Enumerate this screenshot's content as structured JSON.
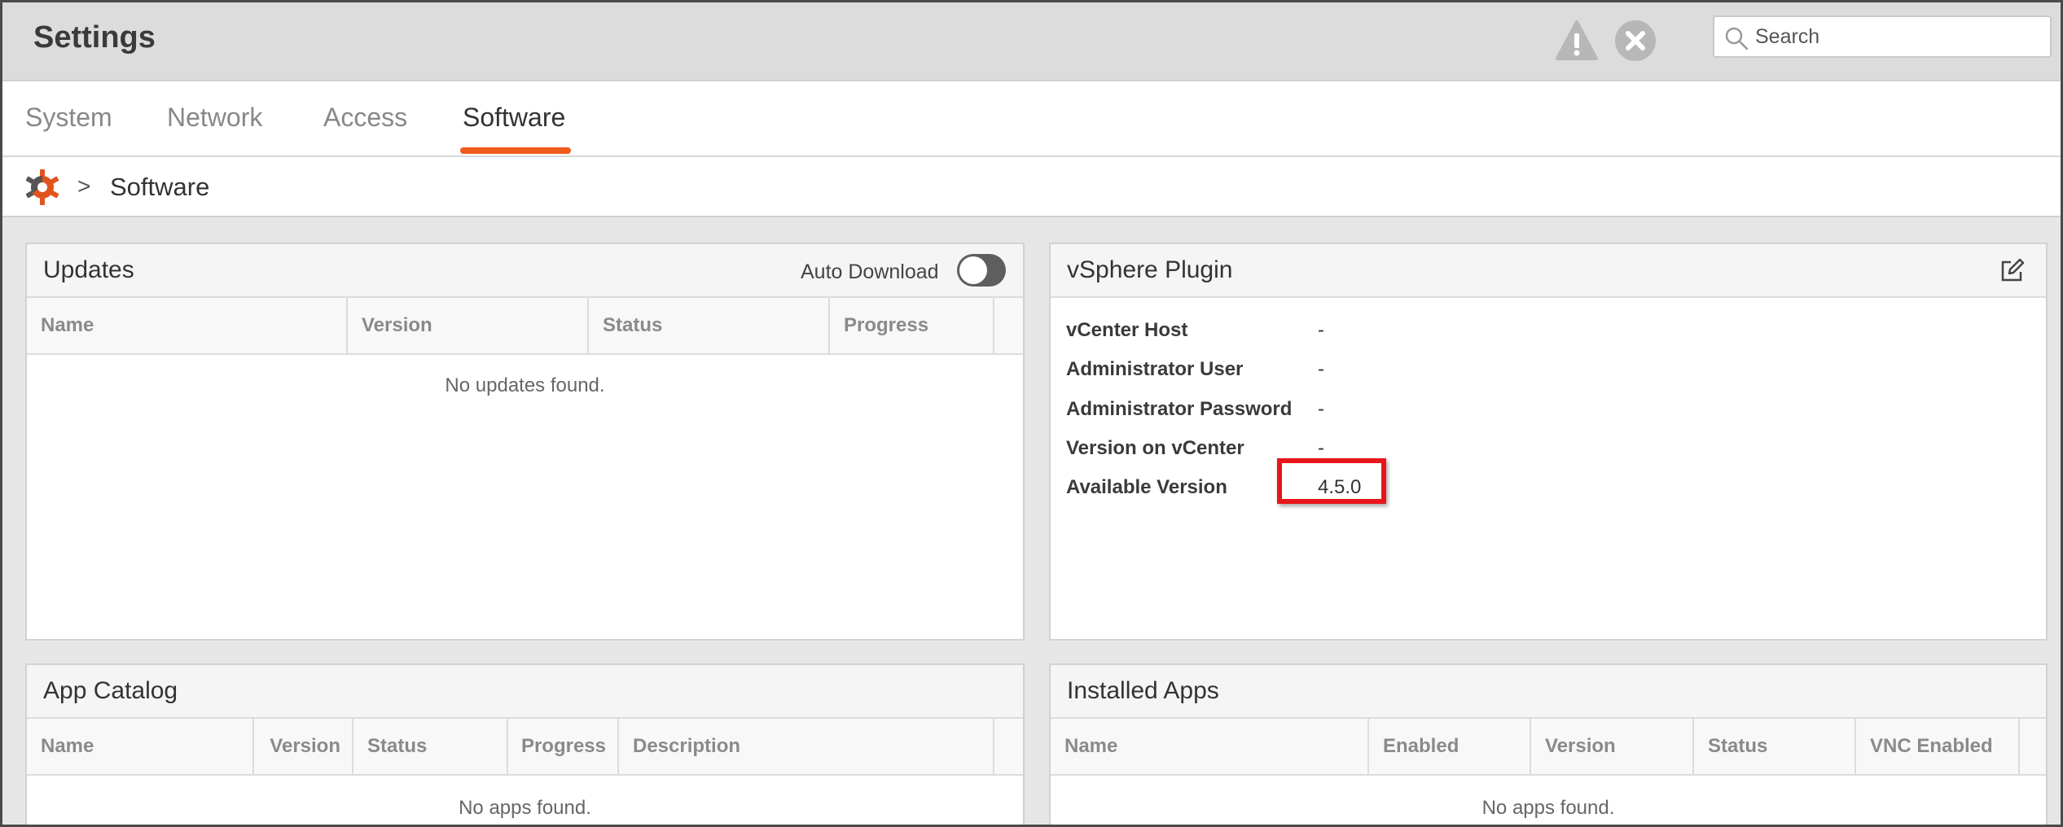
{
  "header": {
    "title": "Settings",
    "search_placeholder": "Search",
    "icons": {
      "warning": "warning-icon",
      "close": "close-icon",
      "search": "search-icon"
    }
  },
  "tabs": [
    {
      "label": "System",
      "active": false
    },
    {
      "label": "Network",
      "active": false
    },
    {
      "label": "Access",
      "active": false
    },
    {
      "label": "Software",
      "active": true
    }
  ],
  "breadcrumb": {
    "separator": ">",
    "current": "Software",
    "root_icon": "settings-gear-icon"
  },
  "updates": {
    "title": "Updates",
    "auto_download_label": "Auto Download",
    "auto_download_on": false,
    "columns": [
      "Name",
      "Version",
      "Status",
      "Progress"
    ],
    "empty_message": "No updates found."
  },
  "vsphere": {
    "title": "vSphere Plugin",
    "rows": [
      {
        "label": "vCenter Host",
        "value": "-"
      },
      {
        "label": "Administrator User",
        "value": "-"
      },
      {
        "label": "Administrator Password",
        "value": "-"
      },
      {
        "label": "Version on vCenter",
        "value": "-"
      },
      {
        "label": "Available Version",
        "value": "4.5.0"
      }
    ]
  },
  "app_catalog": {
    "title": "App Catalog",
    "columns": [
      "Name",
      "Version",
      "Status",
      "Progress",
      "Description"
    ],
    "empty_message": "No apps found."
  },
  "installed_apps": {
    "title": "Installed Apps",
    "columns": [
      "Name",
      "Enabled",
      "Version",
      "Status",
      "VNC Enabled"
    ],
    "empty_message": "No apps found."
  },
  "colors": {
    "accent": "#f05a1a",
    "highlight": "#e8151b",
    "header_bg": "#dcdcdc"
  }
}
